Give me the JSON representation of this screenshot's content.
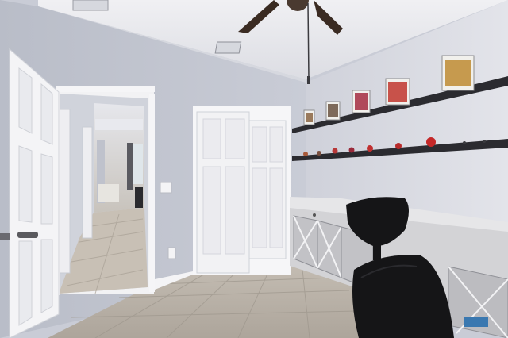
{
  "scene": {
    "colors": {
      "wall_left": "#c4c8d2",
      "wall_right": "#d9dbe2",
      "ceiling": "#e9eaee",
      "floor_tile": "#b9b2a8",
      "door_white": "#f4f4f6",
      "shelf_dark": "#2b2b30",
      "cabinet": "#cfcfd1",
      "chair": "#151517",
      "fan": "#3a2b22"
    },
    "objects": [
      "ceiling-fan",
      "hvac-vent",
      "open-white-door",
      "hallway",
      "closet-sliding-doors",
      "light-switch",
      "wall-outlet",
      "floating-shelves",
      "framed-pictures",
      "figurines",
      "white-sideboard-cabinet",
      "black-office-chair",
      "tile-floor"
    ]
  }
}
